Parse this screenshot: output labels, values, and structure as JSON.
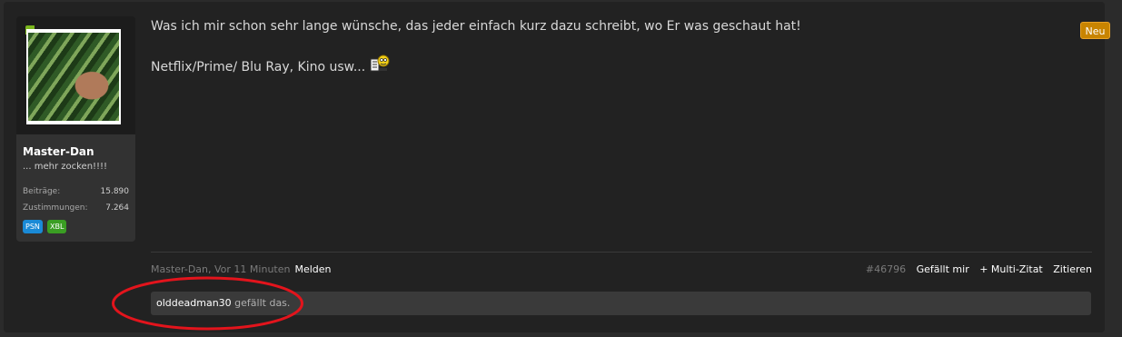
{
  "post": {
    "message_lines": [
      "Was ich mir schon sehr lange wünsche, das jeder einfach kurz dazu schreibt, wo Er was geschaut hat!",
      "Netflix/Prime/ Blu Ray, Kino usw..."
    ],
    "new_badge": "Neu"
  },
  "user": {
    "name": "Master-Dan",
    "title": "... mehr zocken!!!!",
    "stats": [
      {
        "label": "Beiträge:",
        "value": "15.890"
      },
      {
        "label": "Zustimmungen:",
        "value": "7.264"
      }
    ],
    "badges": [
      "PSN",
      "XBL"
    ]
  },
  "footer": {
    "meta": "Master-Dan, Vor 11 Minuten",
    "report_label": "Melden",
    "post_number": "#46796",
    "like_label": "Gefällt mir",
    "multiquote_label": "+ Multi-Zitat",
    "quote_label": "Zitieren"
  },
  "likes": {
    "liker": "olddeadman30",
    "suffix": "gefällt das."
  },
  "colors": {
    "highlight_ring": "#e3141c",
    "new_badge": "#c88400",
    "online": "#7ab51d"
  }
}
